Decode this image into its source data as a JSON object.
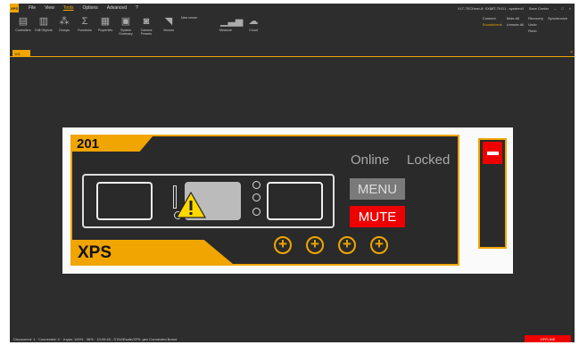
{
  "menubar": {
    "logo": "XPS",
    "items": [
      "File",
      "View",
      "Tools",
      "Options",
      "Advanced"
    ],
    "help": "?",
    "active_index": 2,
    "right_text": "XLT-TECHnet-8: XX88T-TKG1 - system4f",
    "user": "Save Center",
    "window_controls": [
      "–",
      "□",
      "×"
    ]
  },
  "ribbon": {
    "buttons": [
      {
        "label": "Controllers",
        "icon": "controllers-icon"
      },
      {
        "label": "Edit Objects",
        "icon": "edit-objects-icon"
      },
      {
        "label": "Groups",
        "icon": "groups-icon"
      },
      {
        "label": "Functions",
        "icon": "functions-icon"
      },
      {
        "label": "Properties",
        "icon": "properties-icon"
      },
      {
        "label": "System Summary",
        "icon": "system-summary-icon"
      },
      {
        "label": "Camera Presets",
        "icon": "camera-presets-icon"
      },
      {
        "label": "Venues",
        "icon": "venues-icon"
      },
      {
        "label": "Measure",
        "icon": "measure-icon"
      },
      {
        "label": "Cloud",
        "icon": "cloud-icon"
      }
    ],
    "new_venue": "New venue",
    "connect_label": "Connect",
    "soundcheck_label": "Soundcheck",
    "mute_all": "Mute All",
    "unmute_all": "Unmute All",
    "recovery": "Recovery",
    "undo": "Undo",
    "redo": "Redo",
    "synchronize": "Synchronize"
  },
  "tabs": {
    "doc_tab": "101",
    "close": "×"
  },
  "device": {
    "number": "201",
    "type": "XPS",
    "status_online": "Online",
    "status_locked": "Locked",
    "menu_button": "MENU",
    "mute_button": "MUTE",
    "plus_symbol": "+"
  },
  "statusbar": {
    "text": "Discovered: 1 · Connected: 0 · Jnyps: 100% · 36% · 10:09:40 : STAGEsafe/XPS: gen Connected Brand",
    "offline": "OFFLINE"
  },
  "colors": {
    "accent": "#f0a500",
    "alarm": "#e00000",
    "background": "#2d2d2d"
  }
}
